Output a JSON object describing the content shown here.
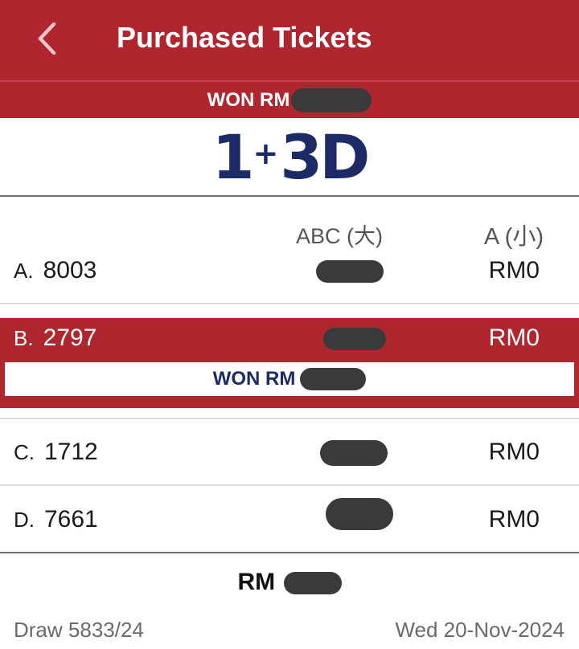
{
  "header": {
    "title": "Purchased Tickets",
    "back_icon": "chevron-left-icon"
  },
  "won_banner": {
    "label": "WON RM"
  },
  "game": {
    "logo_main": "1",
    "logo_plus": "+",
    "logo_suffix": "3D"
  },
  "columns": {
    "abc": "ABC (大)",
    "a": "A (小)"
  },
  "rows": [
    {
      "letter": "A.",
      "number": "8003",
      "a_value": "RM0"
    },
    {
      "letter": "B.",
      "number": "2797",
      "a_value": "RM0",
      "won_label": "WON RM"
    },
    {
      "letter": "C.",
      "number": "1712",
      "a_value": "RM0"
    },
    {
      "letter": "D.",
      "number": "7661",
      "a_value": "RM0"
    }
  ],
  "total": {
    "label": "RM"
  },
  "footer": {
    "draw": "Draw 5833/24",
    "date": "Wed 20-Nov-2024"
  },
  "colors": {
    "brand_red": "#b0262f",
    "logo_navy": "#1c2a66"
  }
}
